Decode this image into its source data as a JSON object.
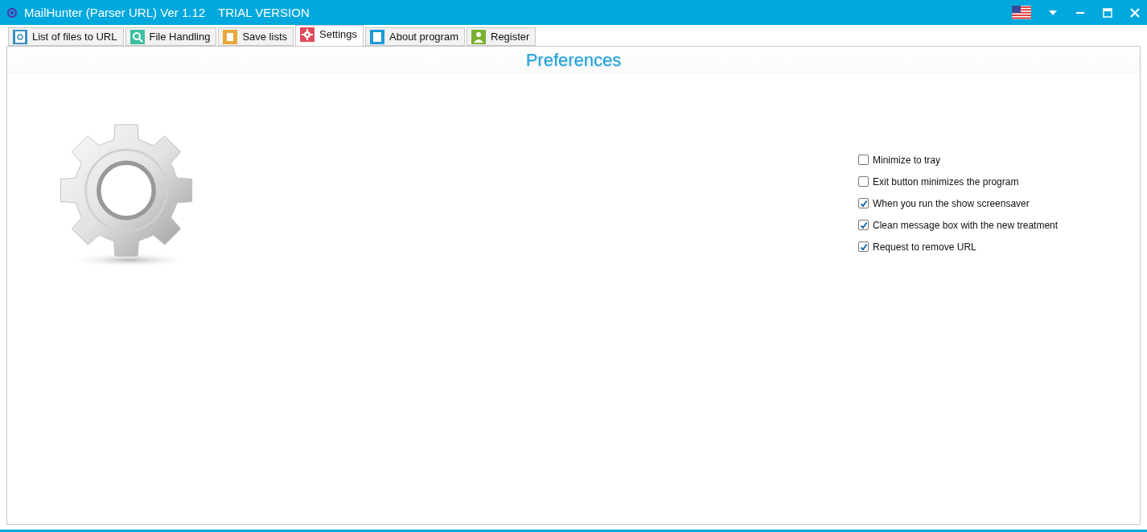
{
  "window": {
    "title": "MailHunter (Parser URL) Ver 1.12",
    "badge": "TRIAL VERSION"
  },
  "tabs": [
    {
      "label": "List of files to URL",
      "selected": false
    },
    {
      "label": "File Handling",
      "selected": false
    },
    {
      "label": "Save lists",
      "selected": false
    },
    {
      "label": "Settings",
      "selected": true
    },
    {
      "label": "About program",
      "selected": false
    },
    {
      "label": "Register",
      "selected": false
    }
  ],
  "panel": {
    "title": "Preferences"
  },
  "options": [
    {
      "label": "Minimize to tray",
      "checked": false
    },
    {
      "label": "Exit button minimizes the program",
      "checked": false
    },
    {
      "label": "When you run the show screensaver",
      "checked": true
    },
    {
      "label": "Clean message box with the new treatment",
      "checked": true
    },
    {
      "label": "Request to remove URL",
      "checked": true
    }
  ]
}
